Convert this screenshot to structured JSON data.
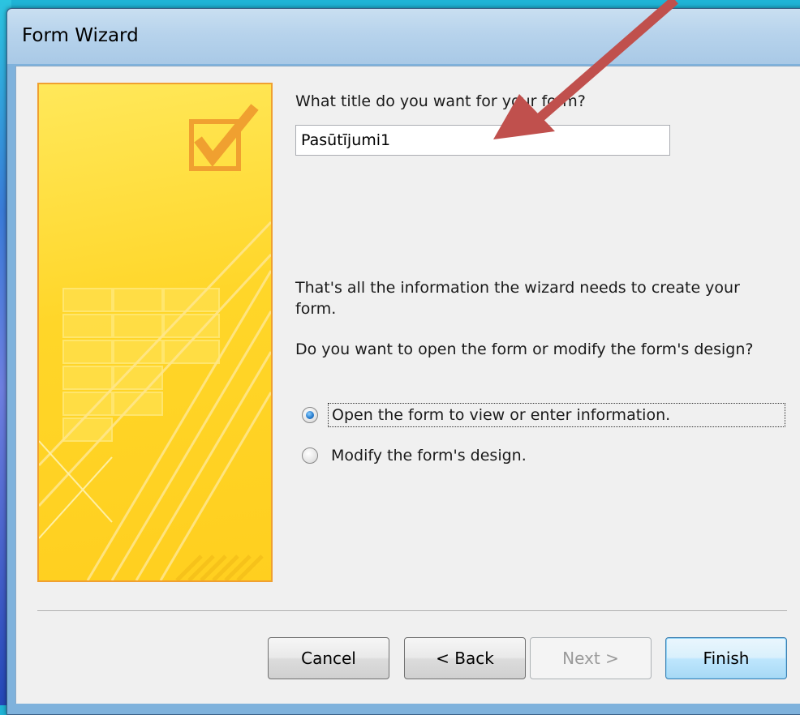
{
  "window": {
    "title": "Form Wizard"
  },
  "prompt": {
    "title_question": "What title do you want for your form?"
  },
  "title_input": {
    "value": "Pasūtījumi1"
  },
  "info": {
    "line1": "That's all the information the wizard needs to create your form.",
    "line2": "Do you want to open the form or modify the form's design?"
  },
  "options": [
    {
      "label": "Open the form to view or enter information.",
      "checked": true
    },
    {
      "label": "Modify the form's design.",
      "checked": false
    }
  ],
  "buttons": {
    "cancel": "Cancel",
    "back": "< Back",
    "next": "Next >",
    "finish": "Finish"
  },
  "colors": {
    "accent": "#c0504d",
    "art_border": "#f0a030",
    "art_fill": "#ffd629"
  }
}
